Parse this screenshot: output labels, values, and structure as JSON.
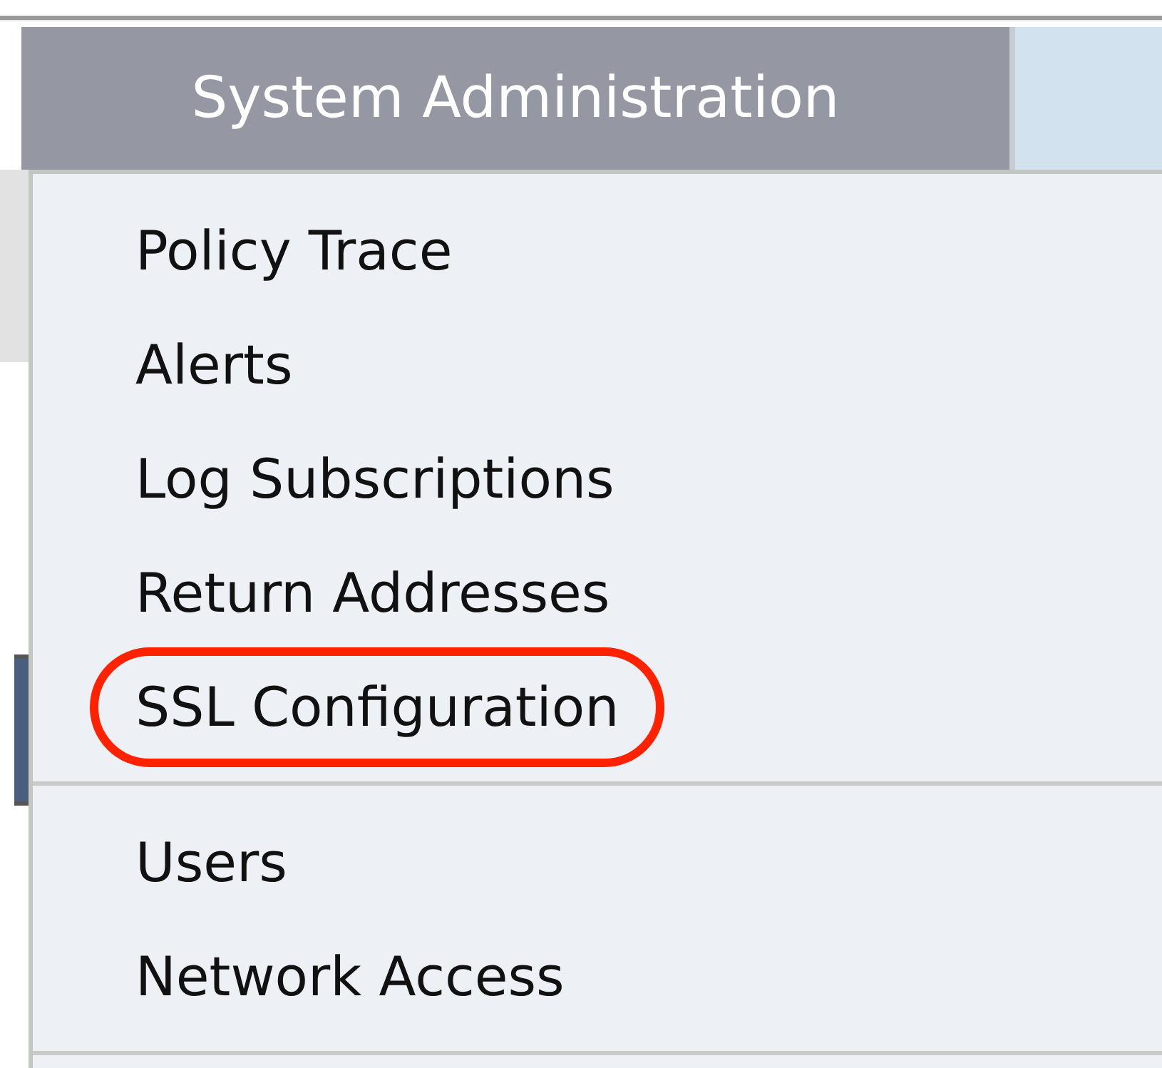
{
  "menu": {
    "title": "System Administration",
    "groups": [
      {
        "items": [
          {
            "label": "Policy Trace",
            "highlighted": false
          },
          {
            "label": "Alerts",
            "highlighted": false
          },
          {
            "label": "Log Subscriptions",
            "highlighted": false
          },
          {
            "label": "Return Addresses",
            "highlighted": false
          },
          {
            "label": "SSL Configuration",
            "highlighted": true
          }
        ]
      },
      {
        "items": [
          {
            "label": "Users",
            "highlighted": false
          },
          {
            "label": "Network Access",
            "highlighted": false
          }
        ]
      }
    ]
  }
}
